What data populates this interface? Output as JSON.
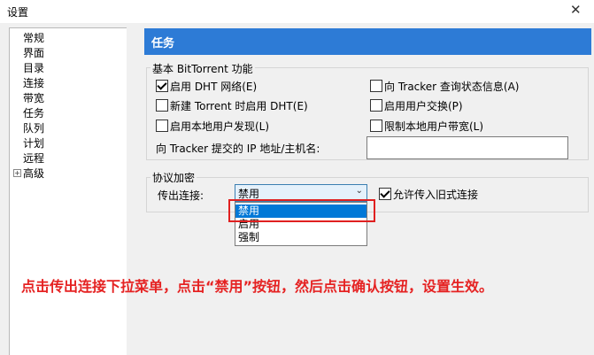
{
  "window": {
    "title": "设置",
    "close_glyph": "✕"
  },
  "sidebar": {
    "items": [
      {
        "label": "常规"
      },
      {
        "label": "界面"
      },
      {
        "label": "目录"
      },
      {
        "label": "连接"
      },
      {
        "label": "带宽"
      },
      {
        "label": "任务"
      },
      {
        "label": "队列"
      },
      {
        "label": "计划"
      },
      {
        "label": "远程"
      },
      {
        "label": "高级",
        "expander": "+"
      }
    ]
  },
  "header": {
    "title": "任务"
  },
  "basic": {
    "group_label": "基本 BitTorrent 功能",
    "options": [
      {
        "label": "启用 DHT 网络(E)",
        "checked": true
      },
      {
        "label": "向 Tracker 查询状态信息(A)",
        "checked": false
      },
      {
        "label": "新建 Torrent 时启用 DHT(E)",
        "checked": false
      },
      {
        "label": "启用用户交换(P)",
        "checked": false
      },
      {
        "label": "启用本地用户发现(L)",
        "checked": false
      },
      {
        "label": "限制本地用户带宽(L)",
        "checked": false
      }
    ],
    "ip_label": "向 Tracker 提交的 IP 地址/主机名:",
    "ip_value": ""
  },
  "encryption": {
    "group_label": "协议加密",
    "outgoing_label": "传出连接:",
    "outgoing_value": "禁用",
    "dropdown_arrow": "⌄",
    "allow_legacy_label": "允许传入旧式连接",
    "allow_legacy_checked": true,
    "options": [
      "禁用",
      "启用",
      "强制"
    ]
  },
  "annotation": {
    "text": "点击传出连接下拉菜单，点击“禁用”按钮，然后点击确认按钮，设置生效。",
    "color": "#e52222"
  },
  "colors": {
    "header_bg": "#2d7bd6",
    "highlight": "#0078d7",
    "callout_border": "#e02020"
  }
}
